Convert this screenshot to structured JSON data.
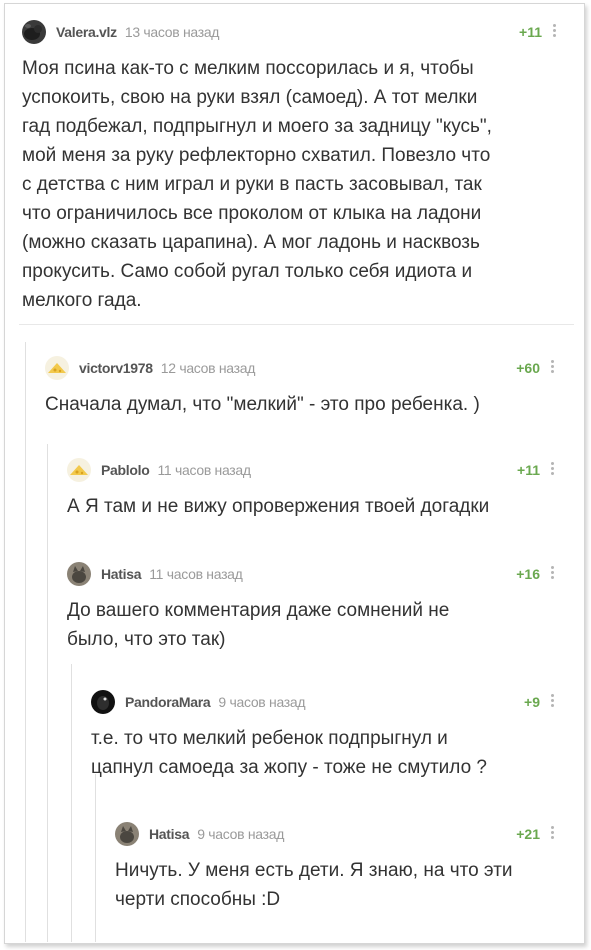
{
  "comments": [
    {
      "user": "Valera.vlz",
      "time": "13 часов назад",
      "score": "+11",
      "text": "Моя псина как-то с мелким поссорилась и я, чтобы\nуспокоить, свою на руки взял (самоед). А тот мелки\nгад подбежал, подпрыгнул и моего за задницу \"кусь\",\nмой меня за руку рефлекторно схватил. Повезло что\nс детства с ним играл и руки в пасть засовывал, так\nчто ограничилось все проколом от клыка на ладони\n(можно сказать царапина). А мог ладонь и насквозь\nпрокусить. Само собой ругал только себя идиота и\nмелкого гада.",
      "avatar": "dark-dog-avatar"
    },
    {
      "user": "victorv1978",
      "time": "12 часов назад",
      "score": "+60",
      "text": "Сначала думал, что \"мелкий\" - это про ребенка. )",
      "avatar": "cheese-avatar"
    },
    {
      "user": "Pablolo",
      "time": "11 часов назад",
      "score": "+11",
      "text": "А Я там и не вижу опровержения твоей догадки",
      "avatar": "cheese-avatar"
    },
    {
      "user": "Hatisa",
      "time": "11 часов назад",
      "score": "+16",
      "text": "До вашего комментария даже сомнений не\nбыло, что это так)",
      "avatar": "cat-avatar"
    },
    {
      "user": "PandoraMara",
      "time": "9 часов назад",
      "score": "+9",
      "text": "т.е. то что мелкий ребенок подпрыгнул и\nцапнул самоеда за жопу - тоже не смутило ?",
      "avatar": "black-bird-avatar"
    },
    {
      "user": "Hatisa",
      "time": "9 часов назад",
      "score": "+21",
      "text": "Ничуть. У меня есть дети. Я знаю, на что эти\nчерти способны :D",
      "avatar": "cat-avatar"
    }
  ],
  "colors": {
    "score": "#6aa84f",
    "username": "#555555",
    "time": "#9a9a9a",
    "text": "#333333"
  }
}
